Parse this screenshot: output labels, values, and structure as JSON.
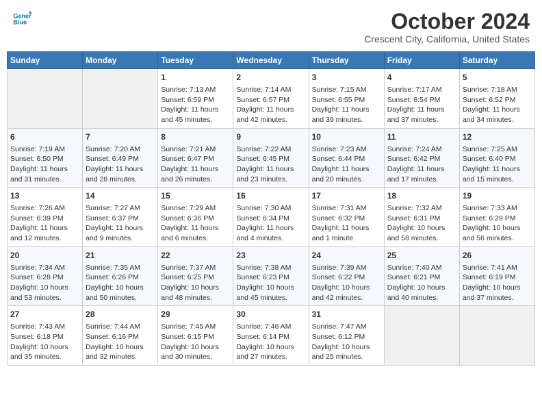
{
  "header": {
    "logo_line1": "General",
    "logo_line2": "Blue",
    "month_title": "October 2024",
    "location": "Crescent City, California, United States"
  },
  "days_of_week": [
    "Sunday",
    "Monday",
    "Tuesday",
    "Wednesday",
    "Thursday",
    "Friday",
    "Saturday"
  ],
  "weeks": [
    [
      {
        "day": "",
        "info": ""
      },
      {
        "day": "",
        "info": ""
      },
      {
        "day": "1",
        "info": "Sunrise: 7:13 AM\nSunset: 6:59 PM\nDaylight: 11 hours and 45 minutes."
      },
      {
        "day": "2",
        "info": "Sunrise: 7:14 AM\nSunset: 6:57 PM\nDaylight: 11 hours and 42 minutes."
      },
      {
        "day": "3",
        "info": "Sunrise: 7:15 AM\nSunset: 6:55 PM\nDaylight: 11 hours and 39 minutes."
      },
      {
        "day": "4",
        "info": "Sunrise: 7:17 AM\nSunset: 6:54 PM\nDaylight: 11 hours and 37 minutes."
      },
      {
        "day": "5",
        "info": "Sunrise: 7:18 AM\nSunset: 6:52 PM\nDaylight: 11 hours and 34 minutes."
      }
    ],
    [
      {
        "day": "6",
        "info": "Sunrise: 7:19 AM\nSunset: 6:50 PM\nDaylight: 11 hours and 31 minutes."
      },
      {
        "day": "7",
        "info": "Sunrise: 7:20 AM\nSunset: 6:49 PM\nDaylight: 11 hours and 28 minutes."
      },
      {
        "day": "8",
        "info": "Sunrise: 7:21 AM\nSunset: 6:47 PM\nDaylight: 11 hours and 26 minutes."
      },
      {
        "day": "9",
        "info": "Sunrise: 7:22 AM\nSunset: 6:45 PM\nDaylight: 11 hours and 23 minutes."
      },
      {
        "day": "10",
        "info": "Sunrise: 7:23 AM\nSunset: 6:44 PM\nDaylight: 11 hours and 20 minutes."
      },
      {
        "day": "11",
        "info": "Sunrise: 7:24 AM\nSunset: 6:42 PM\nDaylight: 11 hours and 17 minutes."
      },
      {
        "day": "12",
        "info": "Sunrise: 7:25 AM\nSunset: 6:40 PM\nDaylight: 11 hours and 15 minutes."
      }
    ],
    [
      {
        "day": "13",
        "info": "Sunrise: 7:26 AM\nSunset: 6:39 PM\nDaylight: 11 hours and 12 minutes."
      },
      {
        "day": "14",
        "info": "Sunrise: 7:27 AM\nSunset: 6:37 PM\nDaylight: 11 hours and 9 minutes."
      },
      {
        "day": "15",
        "info": "Sunrise: 7:29 AM\nSunset: 6:36 PM\nDaylight: 11 hours and 6 minutes."
      },
      {
        "day": "16",
        "info": "Sunrise: 7:30 AM\nSunset: 6:34 PM\nDaylight: 11 hours and 4 minutes."
      },
      {
        "day": "17",
        "info": "Sunrise: 7:31 AM\nSunset: 6:32 PM\nDaylight: 11 hours and 1 minute."
      },
      {
        "day": "18",
        "info": "Sunrise: 7:32 AM\nSunset: 6:31 PM\nDaylight: 10 hours and 58 minutes."
      },
      {
        "day": "19",
        "info": "Sunrise: 7:33 AM\nSunset: 6:29 PM\nDaylight: 10 hours and 56 minutes."
      }
    ],
    [
      {
        "day": "20",
        "info": "Sunrise: 7:34 AM\nSunset: 6:28 PM\nDaylight: 10 hours and 53 minutes."
      },
      {
        "day": "21",
        "info": "Sunrise: 7:35 AM\nSunset: 6:26 PM\nDaylight: 10 hours and 50 minutes."
      },
      {
        "day": "22",
        "info": "Sunrise: 7:37 AM\nSunset: 6:25 PM\nDaylight: 10 hours and 48 minutes."
      },
      {
        "day": "23",
        "info": "Sunrise: 7:38 AM\nSunset: 6:23 PM\nDaylight: 10 hours and 45 minutes."
      },
      {
        "day": "24",
        "info": "Sunrise: 7:39 AM\nSunset: 6:22 PM\nDaylight: 10 hours and 42 minutes."
      },
      {
        "day": "25",
        "info": "Sunrise: 7:40 AM\nSunset: 6:21 PM\nDaylight: 10 hours and 40 minutes."
      },
      {
        "day": "26",
        "info": "Sunrise: 7:41 AM\nSunset: 6:19 PM\nDaylight: 10 hours and 37 minutes."
      }
    ],
    [
      {
        "day": "27",
        "info": "Sunrise: 7:43 AM\nSunset: 6:18 PM\nDaylight: 10 hours and 35 minutes."
      },
      {
        "day": "28",
        "info": "Sunrise: 7:44 AM\nSunset: 6:16 PM\nDaylight: 10 hours and 32 minutes."
      },
      {
        "day": "29",
        "info": "Sunrise: 7:45 AM\nSunset: 6:15 PM\nDaylight: 10 hours and 30 minutes."
      },
      {
        "day": "30",
        "info": "Sunrise: 7:46 AM\nSunset: 6:14 PM\nDaylight: 10 hours and 27 minutes."
      },
      {
        "day": "31",
        "info": "Sunrise: 7:47 AM\nSunset: 6:12 PM\nDaylight: 10 hours and 25 minutes."
      },
      {
        "day": "",
        "info": ""
      },
      {
        "day": "",
        "info": ""
      }
    ]
  ]
}
